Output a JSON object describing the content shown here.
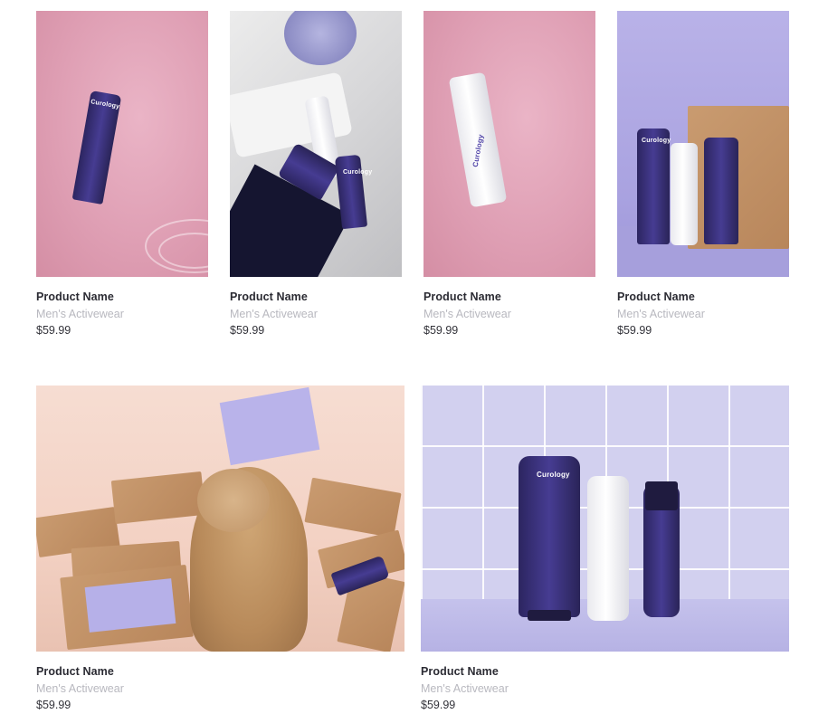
{
  "products": [
    {
      "name": "Product Name",
      "category": "Men's Activewear",
      "price": "$59.99",
      "image_brand": "Curology"
    },
    {
      "name": "Product Name",
      "category": "Men's Activewear",
      "price": "$59.99",
      "image_brand": "Curology"
    },
    {
      "name": "Product Name",
      "category": "Men's Activewear",
      "price": "$59.99",
      "image_brand": "Curology"
    },
    {
      "name": "Product Name",
      "category": "Men's Activewear",
      "price": "$59.99",
      "image_brand": "Curology"
    },
    {
      "name": "Product Name",
      "category": "Men's Activewear",
      "price": "$59.99",
      "image_brand": ""
    },
    {
      "name": "Product Name",
      "category": "Men's Activewear",
      "price": "$59.99",
      "image_brand": "Curology"
    }
  ],
  "colors": {
    "name_text": "#2b2b33",
    "category_text": "#b8b8bf",
    "price_text": "#33333a",
    "product_purple": "#3a3178",
    "pink_background": "#df9fb4",
    "lavender_background": "#b0a9e3"
  }
}
